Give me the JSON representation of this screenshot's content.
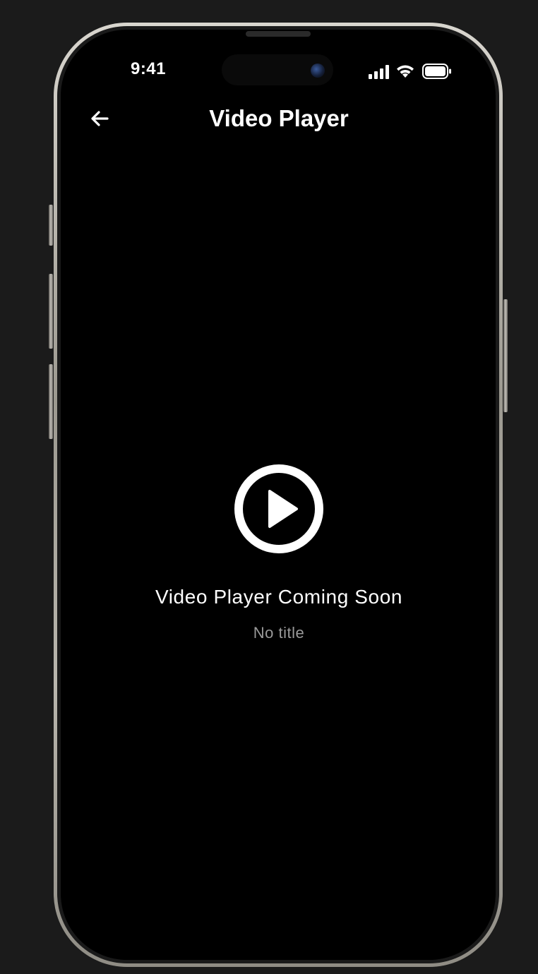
{
  "status_bar": {
    "time": "9:41",
    "icons": [
      "signal-icon",
      "wifi-icon",
      "battery-icon"
    ]
  },
  "nav": {
    "back_icon": "arrow-left-icon",
    "title": "Video Player"
  },
  "main": {
    "play_icon": "play-circle-icon",
    "heading": "Video Player Coming Soon",
    "subtitle": "No title"
  },
  "colors": {
    "background": "#000000",
    "text_primary": "#ffffff",
    "text_secondary": "#9a9a9a",
    "page_background": "#1b1b1b"
  }
}
